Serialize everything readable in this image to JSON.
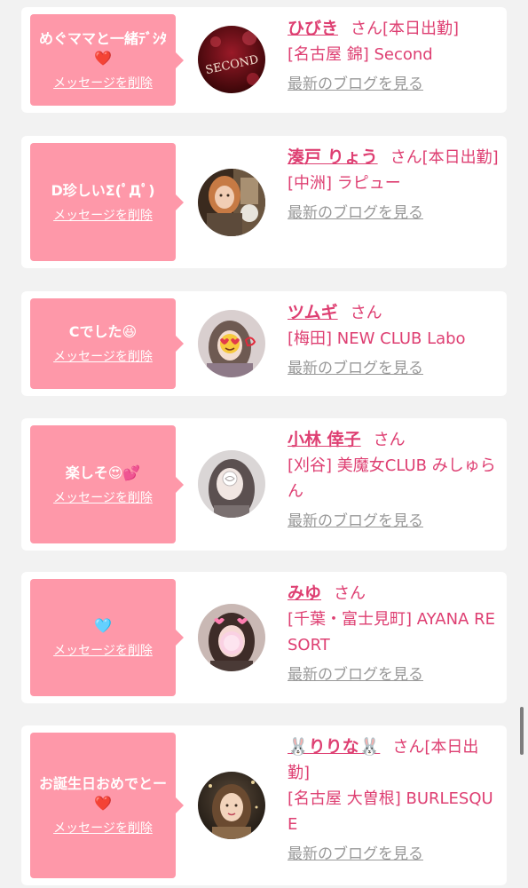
{
  "delete_label": "メッセージを削除",
  "blog_label": "最新のブログを見る",
  "honorific": "さん",
  "colors": {
    "accent": "#de3f72",
    "bubble": "#fe98a9",
    "background": "#f2f2f2",
    "link_gray": "#999999"
  },
  "cards": [
    {
      "message": "めぐママと一緒ﾃﾞｼﾀ❤️",
      "name": "ひびき",
      "status": "[本日出勤]",
      "area": "[名古屋 錦] Second",
      "avatar_icon": "second-club-avatar-icon",
      "avatar_text": "SECOND"
    },
    {
      "message": "D珍しいΣ(ﾟДﾟ)",
      "name": "湊戸 りょう",
      "status": "[本日出勤]",
      "area": "[中洲] ラピュー",
      "avatar_icon": "woman-photo-avatar-icon"
    },
    {
      "message": "Cでした😆",
      "name": "ツムギ",
      "status": "",
      "area": "[梅田] NEW CLUB Labo",
      "avatar_icon": "heart-eyes-photo-avatar-icon"
    },
    {
      "message": "楽しそ😍💕",
      "name": "小林 倖子",
      "status": "",
      "area": "[刈谷] 美魔女CLUB みしゅらん",
      "avatar_icon": "masked-photo-avatar-icon"
    },
    {
      "message": "🩵",
      "name": "みゆ",
      "status": "",
      "area": "[千葉・富士見町] AYANA RESORT",
      "avatar_icon": "heart-filter-photo-avatar-icon"
    },
    {
      "message": "お誕生日おめでとー❤️",
      "name": "🐰りりな🐰",
      "status": "[本日出勤]",
      "area": "[名古屋 大曽根] BURLESQUE",
      "avatar_icon": "glamour-photo-avatar-icon"
    }
  ]
}
